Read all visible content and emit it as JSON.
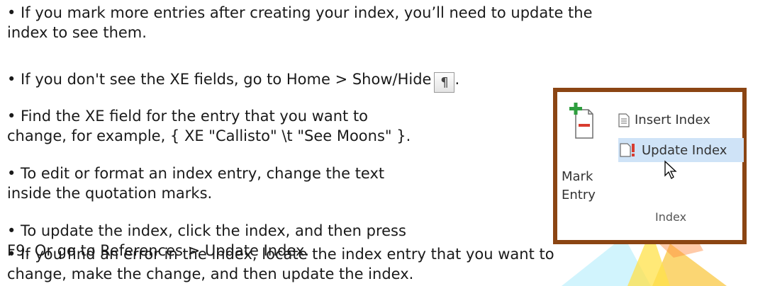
{
  "bullets": {
    "b1": {
      "line1": "• If you mark more entries after creating your index, you’ll need to update the",
      "line2": "index to see them."
    },
    "b2": {
      "text": "• If you don't see the XE fields, go to Home > Show/Hide",
      "tail": "."
    },
    "b3": {
      "line1": "• Find the XE field for the entry that you want to",
      "line2": "change, for example, { XE \"Callisto\" \\t \"See Moons\" }."
    },
    "b4": {
      "line1": "• To edit or format an index entry, change the text",
      "line2": "inside the quotation marks."
    },
    "b5": {
      "line1": "• To update the index, click the index, and then press",
      "line2": "F9. Or go to References > Update  Index."
    },
    "b6": {
      "line1": "• If you find an error in the index, locate the index entry that you want to",
      "line2": "change, make the change, and then update the index."
    }
  },
  "show_hide_button": {
    "glyph": "¶",
    "icon": "pilcrow-icon"
  },
  "ribbon_group": {
    "mark_entry_label_1": "Mark",
    "mark_entry_label_2": "Entry",
    "insert_index_label": "Insert Index",
    "update_index_label": "Update Index",
    "group_label": "Index",
    "border_color": "#8b4513",
    "highlight_color": "#cfe3f7"
  }
}
